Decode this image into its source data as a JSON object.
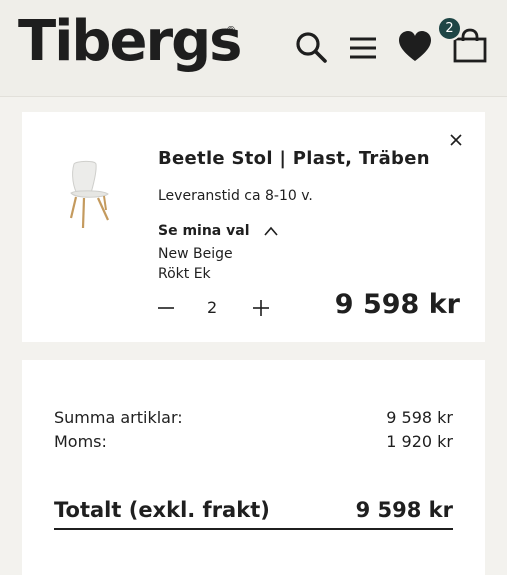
{
  "header": {
    "logo_text": "Tibergs",
    "logo_mark": "®",
    "icons": [
      "search-icon",
      "menu-icon",
      "heart-icon",
      "bag-icon"
    ],
    "cart_count": "2",
    "badge_color": "#1e4545"
  },
  "item": {
    "title": "Beetle Stol | Plast, Träben",
    "lead_time": "Leveranstid ca 8-10 v.",
    "options_label": "Se mina val",
    "options": [
      "New Beige",
      "Rökt Ek"
    ],
    "quantity": "2",
    "price": "9 598 kr"
  },
  "summary": {
    "rows": [
      {
        "label": "Summa artiklar:",
        "value": "9 598 kr"
      },
      {
        "label": "Moms:",
        "value": "1 920 kr"
      }
    ],
    "total_label": "Totalt (exkl. frakt)",
    "total_value": "9 598 kr"
  }
}
